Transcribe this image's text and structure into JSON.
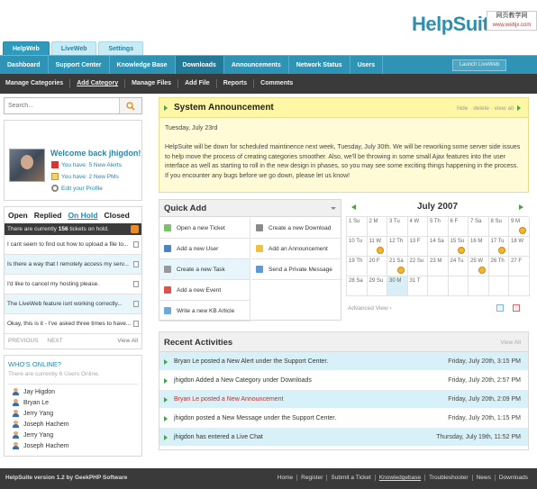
{
  "header": {
    "logo": "HelpSuite",
    "watermark": [
      "网页教学网",
      "www.webjx.com"
    ],
    "top_tabs": [
      "HelpWeb",
      "LiveWeb",
      "Settings"
    ],
    "search_button": "Launch LiveWeb"
  },
  "nav": {
    "primary": [
      "Dashboard",
      "Support Center",
      "Knowledge Base",
      "Downloads",
      "Announcements",
      "Network Status",
      "Users"
    ],
    "secondary": [
      "Manage Categories",
      "Add Category",
      "Manage Files",
      "Add File",
      "Reports",
      "Comments"
    ]
  },
  "sidebar": {
    "search_placeholder": "Search...",
    "welcome": "Welcome back jhigdon!",
    "alerts": "You have: 5 New Alerts",
    "pms": "You have: 2 New PMs",
    "edit_profile": "Edit your Profile",
    "ticket_tabs": [
      "Open",
      "Replied",
      "On Hold",
      "Closed"
    ],
    "hold_prefix": "There are currently ",
    "hold_count": "156",
    "hold_suffix": " tickets on hold.",
    "tickets": [
      "I cant seem to find out how to upload a file to...",
      "Is there a way that I remotely access my serv...",
      "I'd like to cancel my hosting please.",
      "The LiveWeb feature isnt working correctly...",
      "Okay, this is it - I've asked three times to have..."
    ],
    "prev": "PREVIOUS",
    "next": "NEXT",
    "view_all": "View All",
    "online_title": "WHO'S ONLINE?",
    "online_sub": "There are currently 6 Users Online.",
    "online_users": [
      "Jay Higdon",
      "Bryan Le",
      "Jerry Yang",
      "Joseph Hachem",
      "Jerry Yang",
      "Joseph Hachem"
    ]
  },
  "announcement": {
    "title": "System Announcement",
    "actions": "hide · delete · view all",
    "date": "Tuesday, July 23rd",
    "body": "HelpSuite will be down for scheduled maintinence next week, Tuesday, July 30th.  We will be reworking some server side issues to help move the process of creating categories smoother.  Also, we'll be throwing in some small Ajax features into the user interface as well as starting to roll in the new design in phases, so you may see some exciting things happening in the process.  If you encounter any bugs before we go down, please let us know!"
  },
  "quick_add": {
    "title": "Quick Add",
    "left": [
      "Open a new Ticket",
      "Add a new User",
      "Create a new Task",
      "Add a new Event",
      "Write a new KB Article"
    ],
    "right": [
      "Create a new Download",
      "Add an Announcement",
      "Send a Private Message"
    ]
  },
  "calendar": {
    "title": "July 2007",
    "cells": [
      "1 Su",
      "2 M",
      "3 Tu",
      "4 W",
      "5 Th",
      "6 F",
      "7 Sa",
      "8 Su",
      "9 M",
      "10 Tu",
      "11 W",
      "12 Th",
      "13 F",
      "14 Sa",
      "15 Su",
      "16 M",
      "17 Tu",
      "18 W",
      "19 Th",
      "20 F",
      "21 Sa",
      "22 Su",
      "23 M",
      "24 Tu",
      "25 W",
      "26 Th",
      "27 F",
      "28 Sa",
      "29 Su",
      "30 M",
      "31 T",
      "",
      "",
      "",
      "",
      ""
    ],
    "event_days": [
      "9",
      "11",
      "15",
      "17",
      "21",
      "25"
    ],
    "today": "30",
    "advanced": "Advanced View"
  },
  "recent": {
    "title": "Recent Activities",
    "view_all": "View All",
    "items": [
      {
        "text": "Bryan Le posted a New Alert under the Support Center.",
        "date": "Friday, July 20th, 3:15 PM"
      },
      {
        "text": "jhigdon Added a New Category under Downloads",
        "date": "Friday, July 20th, 2:57 PM"
      },
      {
        "text": "Bryan Le posted a New Announcement",
        "date": "Friday, July 20th, 2:09 PM"
      },
      {
        "text": "jhigdon posted a New Message under the Support Center.",
        "date": "Friday, July 20th, 1:15 PM"
      },
      {
        "text": "jhigdon has entered a Live Chat",
        "date": "Thursday, July 19th, 11:52 PM"
      }
    ]
  },
  "footer": {
    "left": "HelpSuite version 1.2 by GeekPHP Software",
    "links": [
      "Home",
      "Register",
      "Submit a Ticket",
      "Knowledgebase",
      "Troubleshooter",
      "News",
      "Downloads"
    ]
  },
  "colors": {
    "accent": "#2e93b5",
    "announcement_bg": "#fffbd6",
    "highlight_row": "#d8f0f8",
    "alert_text": "#c0302a"
  }
}
